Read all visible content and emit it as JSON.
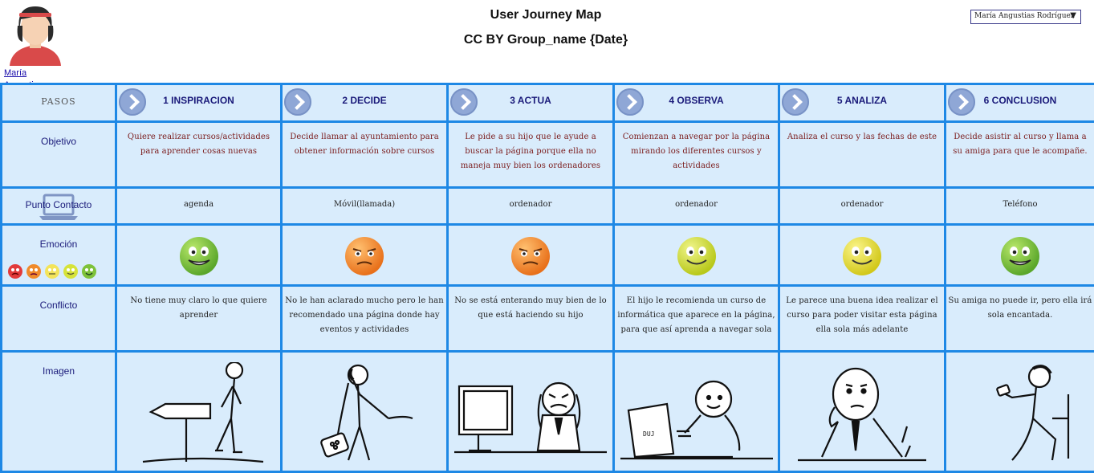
{
  "header": {
    "title": "User Journey Map",
    "subtitle": "CC BY Group_name {Date}"
  },
  "user": {
    "name_link": "María Angustias Rodríguez",
    "selector_value": "María Angustias Rodríguez"
  },
  "rows": {
    "pasos": "PASOS",
    "objetivo": "Objetivo",
    "punto_contacto": "Punto Contacto",
    "emocion": "Emoción",
    "conflicto": "Conflicto",
    "imagen": "Imagen"
  },
  "steps": [
    {
      "title": "1 INSPIRACION",
      "objetivo": "Quiere realizar cursos/actividades para aprender cosas nuevas",
      "contacto": "agenda",
      "emocion": "happy-green",
      "conflicto": "No tiene muy claro lo que quiere aprender",
      "imagen": "person-walking-with-signpost"
    },
    {
      "title": "2 DECIDE",
      "objetivo": "Decide llamar al ayuntamiento para obtener información sobre cursos",
      "contacto": "Móvil(llamada)",
      "emocion": "annoyed-orange",
      "conflicto": "No le han aclarado mucho pero le han recomendado una página donde hay eventos y actividades",
      "imagen": "person-on-phone"
    },
    {
      "title": "3 ACTUA",
      "objetivo": "Le pide a su hijo que le ayude a buscar la página porque ella no maneja muy bien los ordenadores",
      "contacto": "ordenador",
      "emocion": "annoyed-orange",
      "conflicto": "No se está enterando muy bien de lo que está haciendo su hijo",
      "imagen": "person-frustrated-at-computer"
    },
    {
      "title": "4 OBSERVA",
      "objetivo": "Comienzan a navegar por la página mirando los diferentes cursos y actividades",
      "contacto": "ordenador",
      "emocion": "content-lime",
      "conflicto": "El hijo le recomienda un curso de informática que aparece en la página, para que así aprenda a navegar sola",
      "imagen": "person-using-laptop"
    },
    {
      "title": "5 ANALIZA",
      "objetivo": "Analiza el curso y las fechas de este",
      "contacto": "ordenador",
      "emocion": "content-yellow",
      "conflicto": "Le parece una buena idea realizar el curso para poder visitar esta página ella sola más adelante",
      "imagen": "person-thinking"
    },
    {
      "title": "6 CONCLUSION",
      "objetivo": "Decide asistir al curso y llama a su amiga para que le acompañe.",
      "contacto": "Teléfono",
      "emocion": "happy-green",
      "conflicto": "Su amiga no puede ir, pero ella irá sola encantada.",
      "imagen": "person-looking-at-phone"
    }
  ],
  "colors": {
    "grid_border": "#1e88e5",
    "cell_bg": "#d9ecfc",
    "label_text": "#1a1a7a"
  }
}
